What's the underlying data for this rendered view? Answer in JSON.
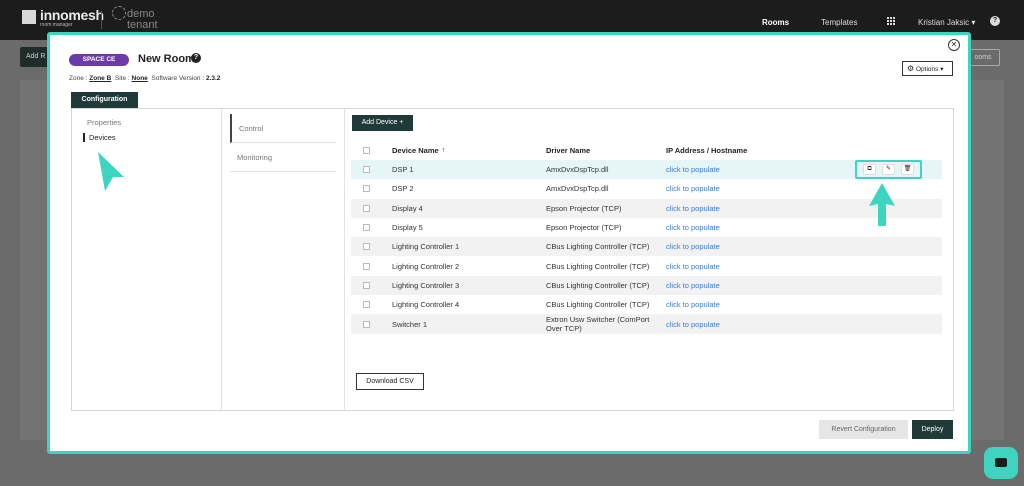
{
  "app": {
    "logo_text": "innomesh",
    "logo_sub": "room manager",
    "tenant": "demo tenant",
    "nav": {
      "rooms": "Rooms",
      "templates": "Templates",
      "user": "Kristian Jaksic ▾",
      "help": "?"
    }
  },
  "background": {
    "add_button": "Add R",
    "rooms_button": "ooms"
  },
  "modal": {
    "close": "✕",
    "space_badge": "SPACE CE",
    "room_title": "New Room",
    "help": "?",
    "meta": {
      "zone_label": "Zone :",
      "zone_value": "Zone B",
      "site_label": "Site :",
      "site_value": "None",
      "sw_label": "Software Version :",
      "sw_value": "2.3.2"
    },
    "options_label": "Options",
    "tab_configuration": "Configuration",
    "left_nav": {
      "properties": "Properties",
      "devices": "Devices"
    },
    "mid_nav": {
      "control": "Control",
      "monitoring": "Monitoring"
    },
    "add_device": "Add Device +",
    "table": {
      "headers": {
        "name": "Device Name",
        "driver": "Driver Name",
        "ip": "IP Address / Hostname"
      },
      "sort_indicator": "↑",
      "rows": [
        {
          "name": "DSP 1",
          "driver": "AmxDvxDspTcp.dll",
          "ip": "click to populate"
        },
        {
          "name": "DSP 2",
          "driver": "AmxDvxDspTcp.dll",
          "ip": "click to populate"
        },
        {
          "name": "Display 4",
          "driver": "Epson Projector (TCP)",
          "ip": "click to populate"
        },
        {
          "name": "Display 5",
          "driver": "Epson Projector (TCP)",
          "ip": "click to populate"
        },
        {
          "name": "Lighting Controller 1",
          "driver": "CBus Lighting Controller (TCP)",
          "ip": "click to populate"
        },
        {
          "name": "Lighting Controller 2",
          "driver": "CBus Lighting Controller (TCP)",
          "ip": "click to populate"
        },
        {
          "name": "Lighting Controller 3",
          "driver": "CBus Lighting Controller (TCP)",
          "ip": "click to populate"
        },
        {
          "name": "Lighting Controller 4",
          "driver": "CBus Lighting Controller (TCP)",
          "ip": "click to populate"
        },
        {
          "name": "Switcher 1",
          "driver": "Extron Usw Switcher (ComPort Over TCP)",
          "ip": "click to populate"
        }
      ]
    },
    "download_csv": "Download CSV",
    "revert_configuration": "Revert Configuration",
    "deploy": "Deploy"
  },
  "colors": {
    "accent": "#3ed4c0",
    "primary": "#1f3a38",
    "badge": "#6d3ba7",
    "link": "#3a7bd5"
  }
}
